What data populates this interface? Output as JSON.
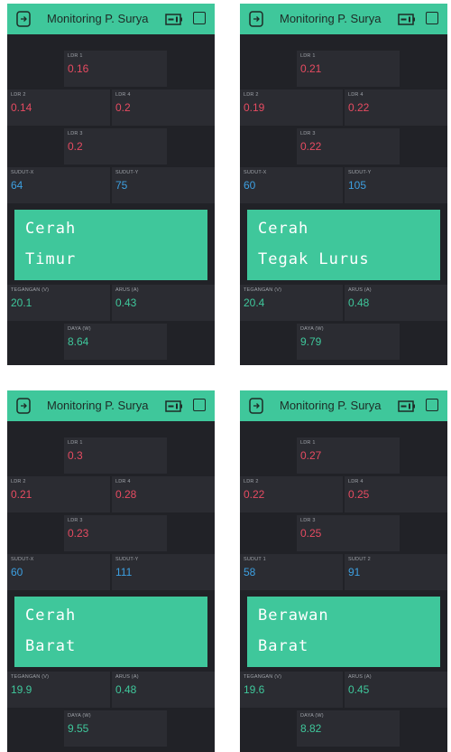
{
  "app_title": "Monitoring P. Surya",
  "colors": {
    "header": "#3fc79b",
    "background": "#212227",
    "widget": "#2b2c32",
    "ldr": "#e64b61",
    "angle": "#3d9fe0",
    "power": "#3fc79b"
  },
  "icons": {
    "exit": "exit-icon",
    "battery": "battery-icon",
    "menu": "square-icon"
  },
  "screens": [
    {
      "ldr1": {
        "label": "LDR 1",
        "value": "0.16"
      },
      "ldr2": {
        "label": "LDR 2",
        "value": "0.14"
      },
      "ldr4": {
        "label": "LDR 4",
        "value": "0.2"
      },
      "ldr3": {
        "label": "LDR 3",
        "value": "0.2"
      },
      "angle_x": {
        "label": "SUDUT-X",
        "value": "64"
      },
      "angle_y": {
        "label": "SUDUT-Y",
        "value": "75"
      },
      "lcd": {
        "line1": "Cerah",
        "line2": "Timur"
      },
      "voltage": {
        "label": "TEGANGAN (V)",
        "value": "20.1"
      },
      "current": {
        "label": "ARUS (A)",
        "value": "0.43"
      },
      "power": {
        "label": "DAYA (W)",
        "value": "8.64"
      }
    },
    {
      "ldr1": {
        "label": "LDR 1",
        "value": "0.21"
      },
      "ldr2": {
        "label": "LDR 2",
        "value": "0.19"
      },
      "ldr4": {
        "label": "LDR 4",
        "value": "0.22"
      },
      "ldr3": {
        "label": "LDR 3",
        "value": "0.22"
      },
      "angle_x": {
        "label": "SUDUT-X",
        "value": "60"
      },
      "angle_y": {
        "label": "SUDUT-Y",
        "value": "105"
      },
      "lcd": {
        "line1": "Cerah",
        "line2": "Tegak Lurus"
      },
      "voltage": {
        "label": "TEGANGAN (V)",
        "value": "20.4"
      },
      "current": {
        "label": "ARUS (A)",
        "value": "0.48"
      },
      "power": {
        "label": "DAYA (W)",
        "value": "9.79"
      }
    },
    {
      "ldr1": {
        "label": "LDR 1",
        "value": "0.3"
      },
      "ldr2": {
        "label": "LDR 2",
        "value": "0.21"
      },
      "ldr4": {
        "label": "LDR 4",
        "value": "0.28"
      },
      "ldr3": {
        "label": "LDR 3",
        "value": "0.23"
      },
      "angle_x": {
        "label": "SUDUT-X",
        "value": "60"
      },
      "angle_y": {
        "label": "SUDUT-Y",
        "value": "111"
      },
      "lcd": {
        "line1": "Cerah",
        "line2": "Barat"
      },
      "voltage": {
        "label": "TEGANGAN (V)",
        "value": "19.9"
      },
      "current": {
        "label": "ARUS (A)",
        "value": "0.48"
      },
      "power": {
        "label": "DAYA (W)",
        "value": "9.55"
      }
    },
    {
      "ldr1": {
        "label": "LDR 1",
        "value": "0.27"
      },
      "ldr2": {
        "label": "LDR 2",
        "value": "0.22"
      },
      "ldr4": {
        "label": "LDR 4",
        "value": "0.25"
      },
      "ldr3": {
        "label": "LDR 3",
        "value": "0.25"
      },
      "angle_x": {
        "label": "SUDUT 1",
        "value": "58"
      },
      "angle_y": {
        "label": "SUDUT 2",
        "value": "91"
      },
      "lcd": {
        "line1": "Berawan",
        "line2": "Barat"
      },
      "voltage": {
        "label": "TEGANGAN (V)",
        "value": "19.6"
      },
      "current": {
        "label": "ARUS (A)",
        "value": "0.45"
      },
      "power": {
        "label": "DAYA (W)",
        "value": "8.82"
      }
    }
  ]
}
